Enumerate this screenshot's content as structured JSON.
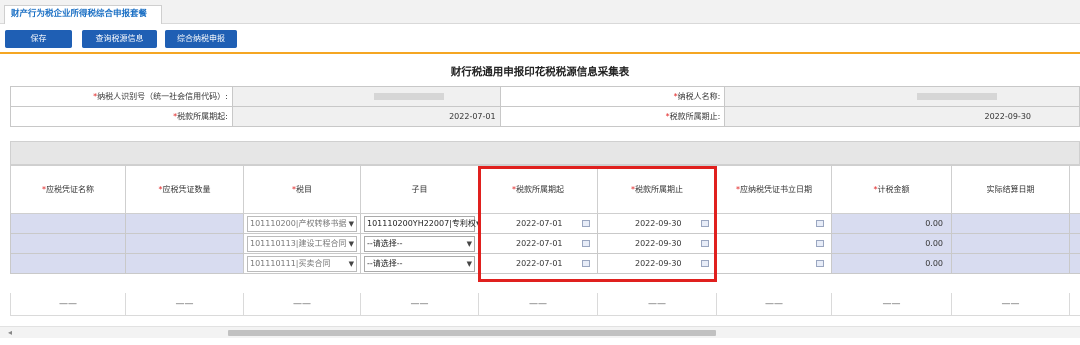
{
  "tab": {
    "label": "财产行为税企业所得税综合申报套餐"
  },
  "toolbar": {
    "save": "保存",
    "query": "查询税源信息",
    "comprehensive": "综合纳税申报"
  },
  "title": "财行税通用申报印花税税源信息采集表",
  "info": {
    "taxpayer_id_label": "纳税人识别号（统一社会信用代码）:",
    "taxpayer_name_label": "纳税人名称:",
    "period_start_label": "税款所属期起:",
    "period_start_value": "2022-07-01",
    "period_end_label": "税款所属期止:",
    "period_end_value": "2022-09-30"
  },
  "grid": {
    "headers": [
      "应税凭证名称",
      "应税凭证数量",
      "税目",
      "子目",
      "税款所属期起",
      "税款所属期止",
      "应纳税凭证书立日期",
      "计税金额",
      "实际结算日期"
    ],
    "rows": [
      {
        "item": "101110200|产权转移书据",
        "subitem": "101110200YH22007|专利权",
        "start": "2022-07-01",
        "end": "2022-09-30",
        "amount": "0.00"
      },
      {
        "item": "101110113|建设工程合同",
        "subitem": "--请选择--",
        "start": "2022-07-01",
        "end": "2022-09-30",
        "amount": "0.00"
      },
      {
        "item": "101110111|买卖合同",
        "subitem": "--请选择--",
        "start": "2022-07-01",
        "end": "2022-09-30",
        "amount": "0.00"
      }
    ],
    "footer_dash": "——"
  },
  "scrollbar": {
    "left_arrow": "◂"
  }
}
